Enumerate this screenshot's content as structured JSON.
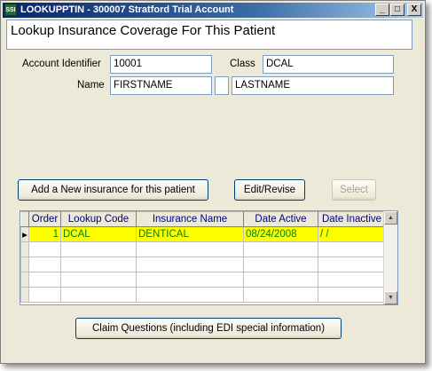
{
  "window": {
    "title": "LOOKUPPTIN - 300007 Stratford Trial Account",
    "icon_label": "SSI",
    "min_label": "_",
    "max_label": "□",
    "close_label": "X"
  },
  "heading": "Lookup Insurance Coverage For This Patient",
  "form": {
    "account_identifier_label": "Account Identifier",
    "account_identifier_value": "10001",
    "class_label": "Class",
    "class_value": "DCAL",
    "name_label": "Name",
    "first_name_value": "FIRSTNAME",
    "middle_initial_value": "",
    "last_name_value": "LASTNAME"
  },
  "buttons": {
    "add_new": "Add a New insurance for this patient",
    "edit_revise": "Edit/Revise",
    "select": "Select",
    "claim_questions": "Claim Questions (including EDI special information)"
  },
  "table": {
    "columns": [
      "Order",
      "Lookup Code",
      "Insurance Name",
      "Date Active",
      "Date Inactive"
    ],
    "rows": [
      {
        "order": "1",
        "lookup_code": "DCAL",
        "insurance_name": "DENTICAL",
        "date_active": "08/24/2008",
        "date_inactive": "/  /"
      }
    ]
  },
  "colors": {
    "selected_row_bg": "#ffff00",
    "selected_row_text": "#008000",
    "header_text": "#000080"
  }
}
